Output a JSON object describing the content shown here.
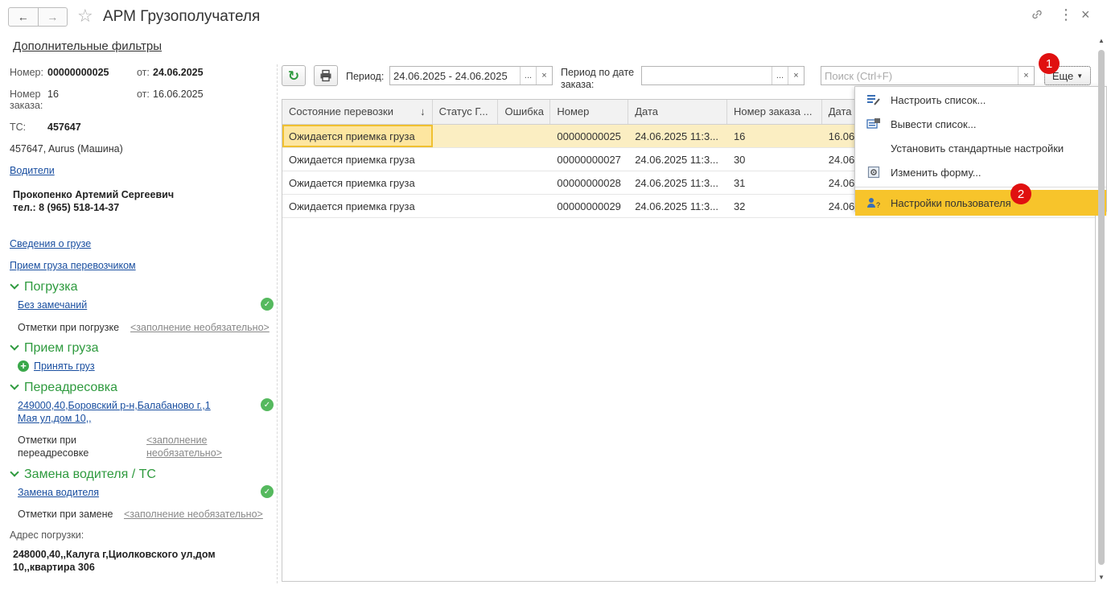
{
  "window": {
    "title": "АРМ Грузополучателя"
  },
  "left": {
    "filters_link": "Дополнительные фильтры",
    "number_label": "Номер:",
    "number_value": "00000000025",
    "from_label": "от:",
    "from_value": "24.06.2025",
    "order_label_1": "Номер",
    "order_label_2": "заказа:",
    "order_value": "16",
    "order_from_label": "от:",
    "order_from_value": "16.06.2025",
    "ts_label": "ТС:",
    "ts_value": "457647",
    "vehicle": "457647, Aurus (Машина)",
    "drivers_link": "Водители",
    "driver_name": "Прокопенко Артемий Сергеевич",
    "driver_phone": "тел.: 8 (965) 518-14-37",
    "cargo_link": "Сведения о грузе",
    "carrier_link": "Прием груза перевозчиком",
    "sec_loading": "Погрузка",
    "no_remarks": "Без замечаний",
    "loading_marks": "Отметки при погрузке",
    "optional": "<заполнение необязательно>",
    "sec_receive": "Прием груза",
    "accept_link": "Принять груз",
    "sec_readdress": "Переадресовка",
    "readdress_addr_1": "249000,40,Боровский р-н,Балабаново г.,1",
    "readdress_addr_2": "Мая ул,дом 10,,",
    "readdress_marks_1": "Отметки при",
    "readdress_marks_2": "переадресовке",
    "optional_1": "<заполнение",
    "optional_2": "необязательно>",
    "sec_replace": "Замена водителя / ТС",
    "replace_link": "Замена водителя",
    "replace_marks": "Отметки при замене",
    "loading_addr_label": "Адрес погрузки:",
    "loading_addr_1": "248000,40,,Калуга г,Циолковского ул,дом",
    "loading_addr_2": "10,,квартира 306"
  },
  "toolbar": {
    "period_label": "Период:",
    "period_value": "24.06.2025 - 24.06.2025",
    "order_period_1": "Период по дате",
    "order_period_2": "заказа:",
    "search_placeholder": "Поиск (Ctrl+F)",
    "more_label": "Еще",
    "dots": "...",
    "clear": "×"
  },
  "table": {
    "columns": [
      "Состояние перевозки",
      "Статус Г...",
      "Ошибка",
      "Номер",
      "Дата",
      "Номер заказа ...",
      "Дата"
    ],
    "sort_indicator": "↓",
    "rows": [
      [
        "Ожидается приемка груза",
        "",
        "",
        "00000000025",
        "24.06.2025 11:3...",
        "16",
        "16.06"
      ],
      [
        "Ожидается приемка груза",
        "",
        "",
        "00000000027",
        "24.06.2025 11:3...",
        "30",
        "24.06"
      ],
      [
        "Ожидается приемка груза",
        "",
        "",
        "00000000028",
        "24.06.2025 11:3...",
        "31",
        "24.06"
      ],
      [
        "Ожидается приемка груза",
        "",
        "",
        "00000000029",
        "24.06.2025 11:3...",
        "32",
        "24.06"
      ]
    ]
  },
  "menu": {
    "items": [
      "Настроить список...",
      "Вывести список...",
      "Установить стандартные настройки",
      "Изменить форму...",
      "Настройки пользователя"
    ]
  },
  "badges": {
    "one": "1",
    "two": "2"
  },
  "colors": {
    "accent_green": "#2e9a3e",
    "highlight": "#f7c42b",
    "link": "#1a4fa0",
    "badge": "#e01010"
  }
}
